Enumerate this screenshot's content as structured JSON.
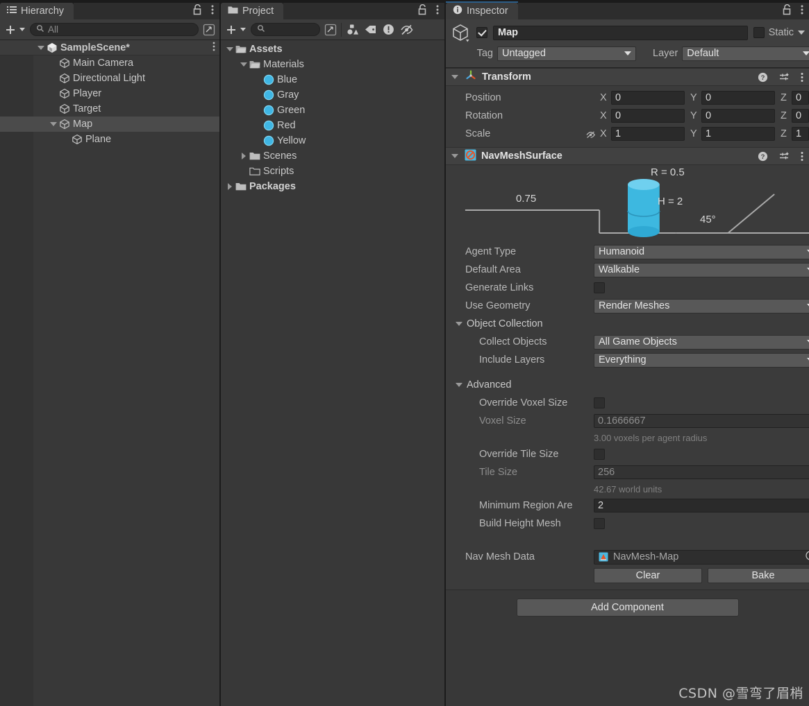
{
  "hierarchy": {
    "tab_label": "Hierarchy",
    "tab_icon": "hierarchy-list-icon",
    "toolbar": {
      "add_label": "+",
      "search_placeholder": "All"
    },
    "rows": [
      {
        "label": "SampleScene*",
        "icon": "unity-scene-icon",
        "depth": 1,
        "twirl": "down",
        "selected": false,
        "scene": true
      },
      {
        "label": "Main Camera",
        "icon": "gameobject-cube-icon",
        "depth": 2,
        "twirl": "none",
        "selected": false
      },
      {
        "label": "Directional Light",
        "icon": "gameobject-cube-icon",
        "depth": 2,
        "twirl": "none",
        "selected": false
      },
      {
        "label": "Player",
        "icon": "gameobject-cube-icon",
        "depth": 2,
        "twirl": "none",
        "selected": false
      },
      {
        "label": "Target",
        "icon": "gameobject-cube-icon",
        "depth": 2,
        "twirl": "none",
        "selected": false
      },
      {
        "label": "Map",
        "icon": "gameobject-cube-icon",
        "depth": 2,
        "twirl": "down",
        "selected": true
      },
      {
        "label": "Plane",
        "icon": "gameobject-cube-icon",
        "depth": 3,
        "twirl": "none",
        "selected": false
      }
    ]
  },
  "project": {
    "tab_label": "Project",
    "tab_icon": "folder-icon",
    "toolbar": {
      "add_label": "+",
      "search_placeholder": "",
      "icons": [
        "filter-by-type-icon",
        "filter-by-label-icon",
        "warning-icon",
        "hidden-eye-icon"
      ]
    },
    "rows": [
      {
        "label": "Assets",
        "icon": "folder-open-icon",
        "depth": 0,
        "twirl": "down",
        "bold": true
      },
      {
        "label": "Materials",
        "icon": "folder-open-icon",
        "depth": 1,
        "twirl": "down",
        "bold": false
      },
      {
        "label": "Blue",
        "icon": "material-ball-icon",
        "depth": 2,
        "twirl": "none",
        "bold": false
      },
      {
        "label": "Gray",
        "icon": "material-ball-icon",
        "depth": 2,
        "twirl": "none",
        "bold": false
      },
      {
        "label": "Green",
        "icon": "material-ball-icon",
        "depth": 2,
        "twirl": "none",
        "bold": false
      },
      {
        "label": "Red",
        "icon": "material-ball-icon",
        "depth": 2,
        "twirl": "none",
        "bold": false
      },
      {
        "label": "Yellow",
        "icon": "material-ball-icon",
        "depth": 2,
        "twirl": "none",
        "bold": false
      },
      {
        "label": "Scenes",
        "icon": "folder-icon",
        "depth": 1,
        "twirl": "right",
        "bold": false
      },
      {
        "label": "Scripts",
        "icon": "folder-empty-icon",
        "depth": 1,
        "twirl": "none",
        "bold": false
      },
      {
        "label": "Packages",
        "icon": "folder-icon",
        "depth": 0,
        "twirl": "right",
        "bold": true
      }
    ]
  },
  "inspector": {
    "tab_label": "Inspector",
    "tab_icon": "info-icon",
    "object": {
      "enabled": true,
      "name": "Map",
      "static_label": "Static",
      "static_checked": false,
      "tag_label": "Tag",
      "tag_value": "Untagged",
      "layer_label": "Layer",
      "layer_value": "Default"
    },
    "transform": {
      "title": "Transform",
      "expanded": true,
      "rows": [
        {
          "label": "Position",
          "x": "0",
          "y": "0",
          "z": "0",
          "lock": false
        },
        {
          "label": "Rotation",
          "x": "0",
          "y": "0",
          "z": "0",
          "lock": false
        },
        {
          "label": "Scale",
          "x": "1",
          "y": "1",
          "z": "1",
          "lock": true
        }
      ],
      "axis_labels": [
        "X",
        "Y",
        "Z"
      ]
    },
    "navmeshsurface": {
      "title": "NavMeshSurface",
      "enabled": true,
      "expanded": true,
      "diagram": {
        "radius_label": "R = 0.5",
        "height_label": "H = 2",
        "step_label": "0.75",
        "slope_label": "45°"
      },
      "fields": [
        {
          "label": "Agent Type",
          "type": "dropdown",
          "value": "Humanoid"
        },
        {
          "label": "Default Area",
          "type": "dropdown",
          "value": "Walkable"
        },
        {
          "label": "Generate Links",
          "type": "checkbox",
          "value": false
        },
        {
          "label": "Use Geometry",
          "type": "dropdown",
          "value": "Render Meshes"
        }
      ],
      "object_collection": {
        "title": "Object Collection",
        "expanded": true,
        "fields": [
          {
            "label": "Collect Objects",
            "type": "dropdown",
            "value": "All Game Objects"
          },
          {
            "label": "Include Layers",
            "type": "dropdown",
            "value": "Everything"
          }
        ]
      },
      "advanced": {
        "title": "Advanced",
        "expanded": true,
        "override_voxel_size": {
          "label": "Override Voxel Size",
          "value": false
        },
        "voxel_size": {
          "label": "Voxel Size",
          "value": "0.1666667"
        },
        "voxel_hint": "3.00 voxels per agent radius",
        "override_tile_size": {
          "label": "Override Tile Size",
          "value": false
        },
        "tile_size": {
          "label": "Tile Size",
          "value": "256"
        },
        "tile_hint": "42.67 world units",
        "minimum_region_area": {
          "label": "Minimum Region Are",
          "value": "2"
        },
        "build_height_mesh": {
          "label": "Build Height Mesh",
          "value": false
        }
      },
      "nav_mesh_data": {
        "label": "Nav Mesh Data",
        "value": "NavMesh-Map",
        "icon": "navmesh-asset-icon"
      },
      "buttons": {
        "clear": "Clear",
        "bake": "Bake"
      }
    },
    "add_component_label": "Add Component"
  },
  "watermark": "CSDN @雪弯了眉梢",
  "colors": {
    "panel_bg": "#383838",
    "panel_header": "#3c3c3c",
    "window_bg": "#1b1b1b",
    "accent_blue": "#2c5d87",
    "cyan": "#46b9e0",
    "orange": "#e2552a",
    "selected_row": "#4b4b4b"
  }
}
